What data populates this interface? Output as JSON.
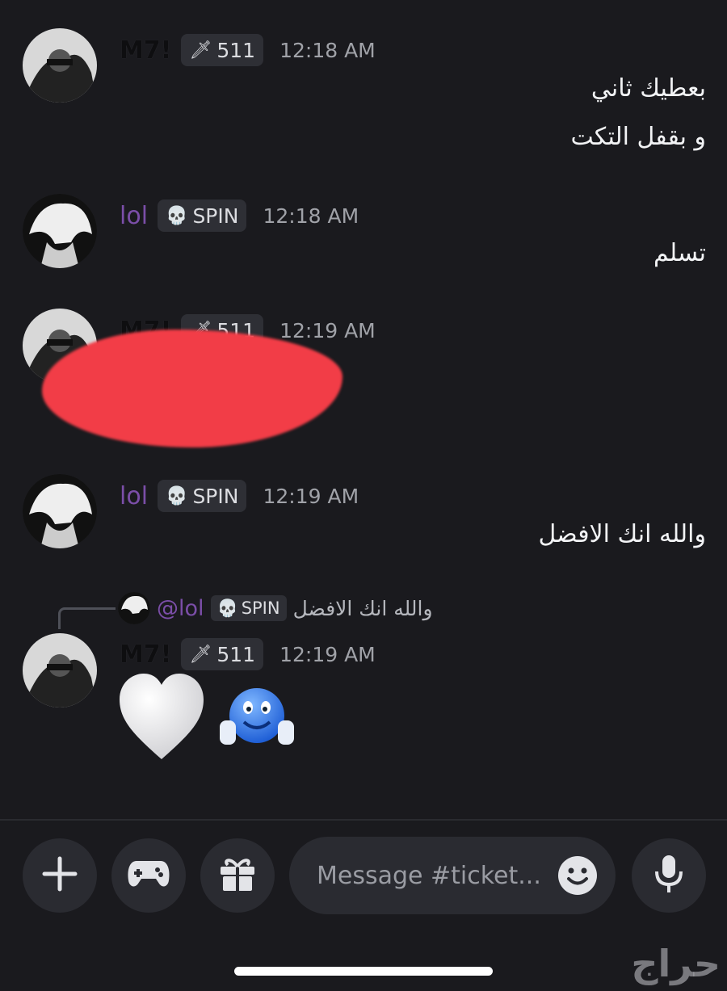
{
  "messages": [
    {
      "username": "M7!",
      "tag_icon": "sword-icon",
      "tag_text": "511",
      "time": "12:18 AM",
      "lines": [
        "بعطيك ثاني",
        "و بقفل التكت"
      ]
    },
    {
      "username": "lol",
      "tag_icon": "skull-icon",
      "tag_text": "SPIN",
      "time": "12:18 AM",
      "lines": [
        "تسلم"
      ]
    },
    {
      "username": "M7!",
      "tag_icon": "sword-icon",
      "tag_text": "511",
      "time": "12:19 AM",
      "lines": []
    },
    {
      "username": "lol",
      "tag_icon": "skull-icon",
      "tag_text": "SPIN",
      "time": "12:19 AM",
      "lines": [
        "والله انك الافضل"
      ]
    },
    {
      "username": "M7!",
      "tag_icon": "sword-icon",
      "tag_text": "511",
      "time": "12:19 AM",
      "lines": [],
      "emojis": [
        "white-heart-emoji",
        "thumbs-up-smiley-emoji"
      ]
    }
  ],
  "reply": {
    "mention": "@lol",
    "tag_text": "SPIN",
    "text": "والله انك الافضل"
  },
  "composer": {
    "placeholder": "Message #ticket..."
  },
  "watermark": "حراج",
  "colors": {
    "background": "#1a1a1e",
    "username_purple": "#7b4ea8",
    "redaction_red": "#f23d47"
  }
}
